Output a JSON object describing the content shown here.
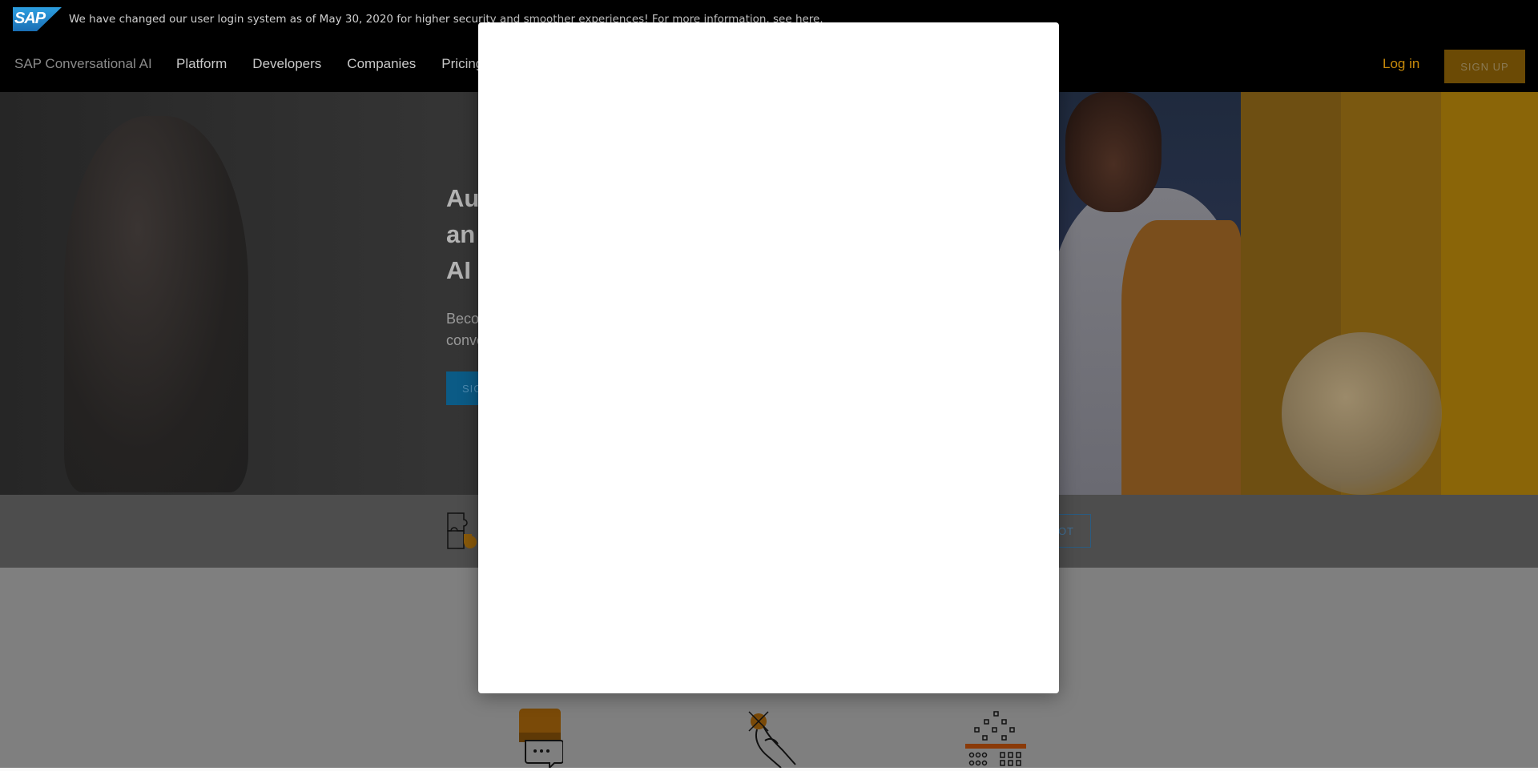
{
  "announcement": {
    "logo_text": "SAP",
    "message": "We have changed our user login system as of May 30, 2020 for higher security and smoother experiences! For more information, see here."
  },
  "header": {
    "brand": "SAP Conversational AI",
    "nav": [
      "Platform",
      "Developers",
      "Companies",
      "Pricing"
    ],
    "login": "Log in",
    "signup": "SIGN UP"
  },
  "hero": {
    "title_lines": [
      "Au",
      "an",
      "AI c"
    ],
    "subtitle_lines": [
      "Beco",
      "conve"
    ],
    "cta": "SIG"
  },
  "strip": {
    "button_fragment": "OT"
  },
  "icons": {
    "puzzle": "puzzle-icon",
    "chat": "chat-bubble-icon",
    "hand": "hand-touch-icon",
    "grid": "data-grid-icon",
    "logo": "sap-logo"
  },
  "colors": {
    "accent_gold": "#f0ab00",
    "primary_blue": "#0a6ed1",
    "overlay": "rgba(0,0,0,0.5)"
  }
}
